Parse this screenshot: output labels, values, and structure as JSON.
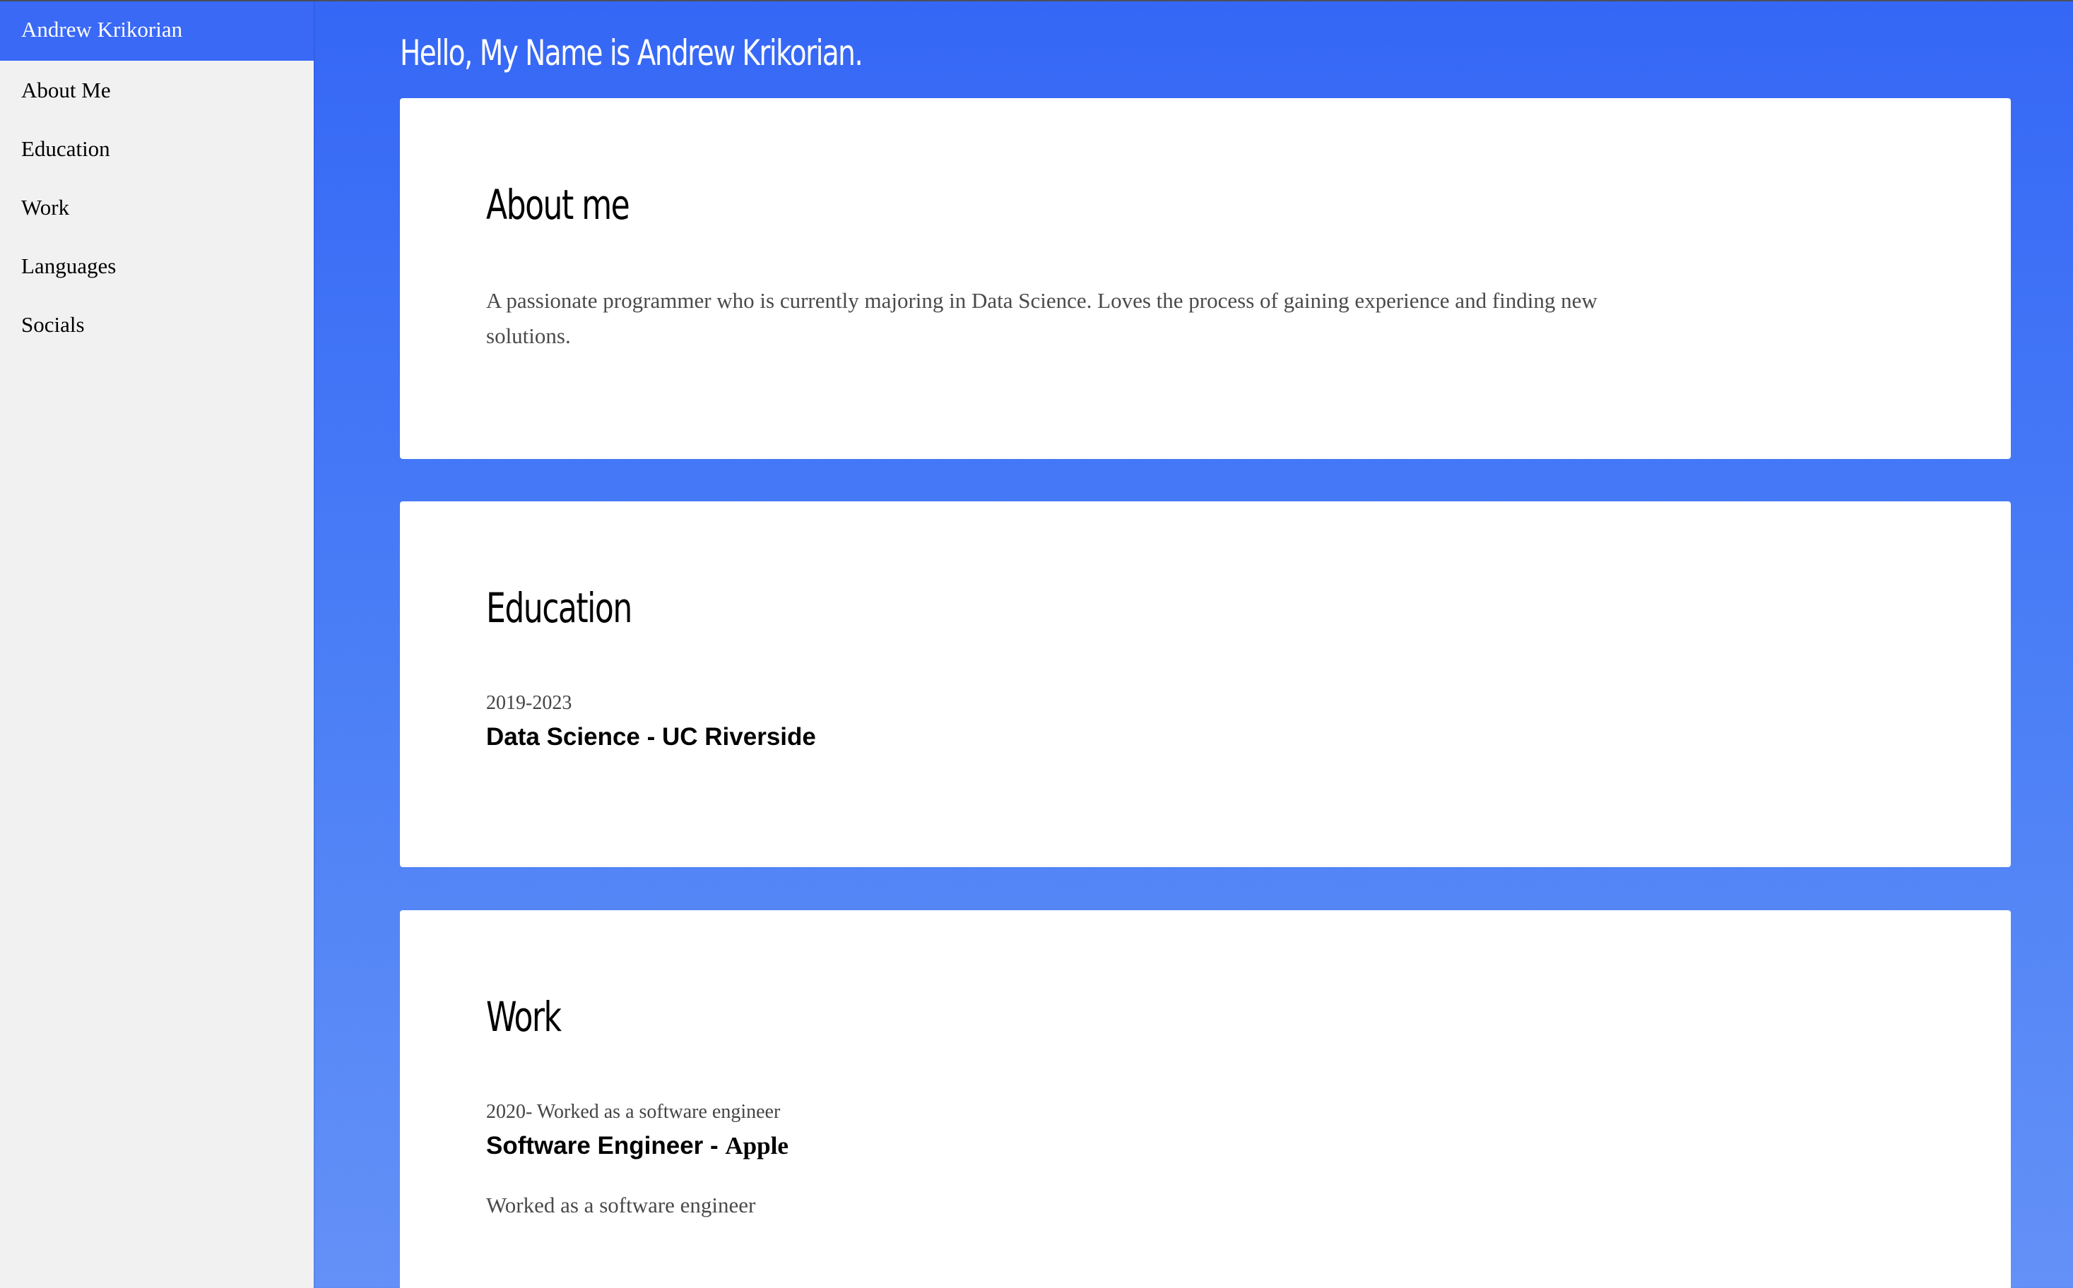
{
  "sidebar": {
    "brand": "Andrew Krikorian",
    "items": [
      {
        "label": "About Me"
      },
      {
        "label": "Education"
      },
      {
        "label": "Work"
      },
      {
        "label": "Languages"
      },
      {
        "label": "Socials"
      }
    ]
  },
  "header": {
    "title": "Hello, My Name is Andrew Krikorian."
  },
  "about": {
    "title": "About me",
    "text": "A passionate programmer who is currently majoring in Data Science. Loves the process of gaining experience and finding new solutions."
  },
  "education": {
    "title": "Education",
    "entries": [
      {
        "date": "2019-2023",
        "title": "Data Science - UC Riverside"
      }
    ]
  },
  "work": {
    "title": "Work",
    "entries": [
      {
        "date": "2020- Worked as a software engineer",
        "title": "Software Engineer - ",
        "company": "Apple",
        "description": "Worked as a software engineer"
      }
    ]
  },
  "colors": {
    "accent": "#3567f6",
    "sidebar_bg": "#f1f1f1",
    "card_bg": "#ffffff",
    "brand_bg": "#3a69f6"
  }
}
